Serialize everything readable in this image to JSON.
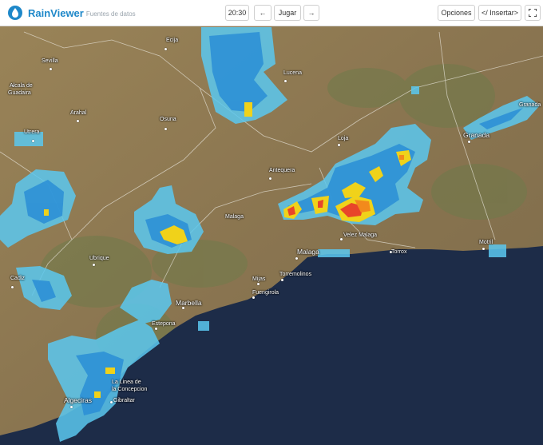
{
  "app": {
    "name": "RainViewer",
    "subtitle": "Fuentes de datos"
  },
  "toolbar": {
    "time": "20:30",
    "prev_label": "←",
    "play_label": "Jugar",
    "next_label": "→",
    "options_label": "Opciones",
    "embed_label": "</ Insertar>",
    "fullscreen_icon": "fullscreen-icon"
  },
  "places": {
    "ecija": "Ecija",
    "sevilla": "Sevilla",
    "alcala": "Alcala de",
    "guadaira": "Guadaira",
    "arahal": "Arahal",
    "osuna": "Osuna",
    "utrera": "Utrera",
    "lucena": "Lucena",
    "granada_ne": "Granada",
    "granada": "Granada",
    "loja": "Loja",
    "antequera": "Antequera",
    "malaga_inland": "Malaga",
    "ubrique": "Ubrique",
    "cadiz": "Cadiz",
    "marbella": "Marbella",
    "estepona": "Estepona",
    "mijas": "Mijas",
    "fuengirola": "Fuengirola",
    "torremolinos": "Torremolinos",
    "malaga": "Malaga",
    "velez": "Velez Malaga",
    "torrox": "Torrox",
    "motril": "Motril",
    "lalinea1": "La Linea de",
    "lalinea2": "la Concepcion",
    "algeciras": "Algeciras",
    "gibraltar": "Gibraltar"
  },
  "colors": {
    "land": "#8f7a52",
    "sea": "#1d2c48",
    "radar_light": "#5bc8f0",
    "radar_mid": "#2a8ed6",
    "radar_heavy": "#f0d21a",
    "radar_intense": "#e8452a"
  }
}
